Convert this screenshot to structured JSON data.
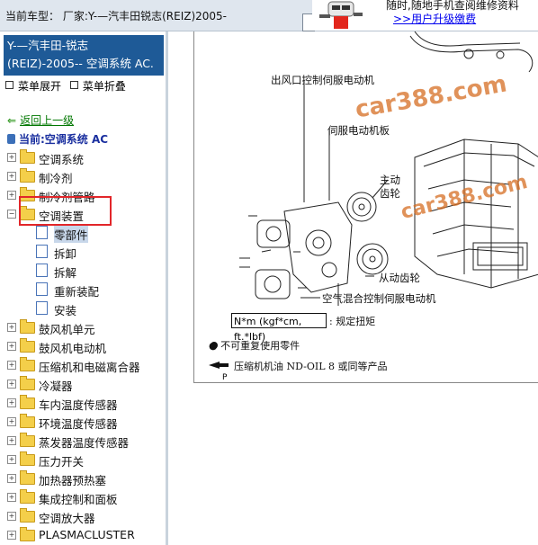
{
  "topbar": {
    "car_label": "当前车型：  厂家:Y-—汽丰田锐志(REIZ)2005-",
    "promo_line1": "随时,随地手机查阅维修资料",
    "promo_line2": ">>用户升级缴费"
  },
  "left": {
    "title_line1": "Y-—汽丰田-锐志",
    "title_line2": "(REIZ)-2005-- 空调系统 AC.",
    "expand_label": "菜单展开",
    "collapse_label": "菜单折叠",
    "back_label": "返回上一级",
    "current_label": "当前:空调系统 AC",
    "tree_items": [
      {
        "label": "空调系统"
      },
      {
        "label": "制冷剂"
      },
      {
        "label": "制冷剂管路"
      },
      {
        "label": "空调装置"
      }
    ],
    "sub_items": [
      {
        "label": "零部件"
      },
      {
        "label": "拆卸"
      },
      {
        "label": "拆解"
      },
      {
        "label": "重新装配"
      },
      {
        "label": "安装"
      }
    ],
    "tree_items_after": [
      {
        "label": "鼓风机单元"
      },
      {
        "label": "鼓风机电动机"
      },
      {
        "label": "压缩机和电磁离合器"
      },
      {
        "label": "冷凝器"
      },
      {
        "label": "车内温度传感器"
      },
      {
        "label": "环境温度传感器"
      },
      {
        "label": "蒸发器温度传感器"
      },
      {
        "label": "压力开关"
      },
      {
        "label": "加热器预热塞"
      },
      {
        "label": "集成控制和面板"
      },
      {
        "label": "空调放大器"
      },
      {
        "label": "PLASMACLUSTER"
      }
    ]
  },
  "diagram": {
    "label_outlet": "出风口控制伺服电动机",
    "label_board": "伺服电动机板",
    "label_drive1": "主动",
    "label_drive2": "齿轮",
    "label_driven": "从动齿轮",
    "label_mix": "空气混合控制伺服电动机",
    "torque_box": "N*m (kgf*cm, ft.*lbf)",
    "torque_text": ": 规定扭矩",
    "legend_reuse": "●  不可重复使用零件",
    "legend_oil": "压缩机机油 ND-OIL 8 或同等产品",
    "page_letter": "P",
    "watermark1": "car388.com",
    "watermark2": "car388.com"
  },
  "colors": {
    "title_bg": "#1e5a97",
    "highlight": "#e2262a",
    "link": "#007700",
    "watermark": "#d66e23"
  }
}
